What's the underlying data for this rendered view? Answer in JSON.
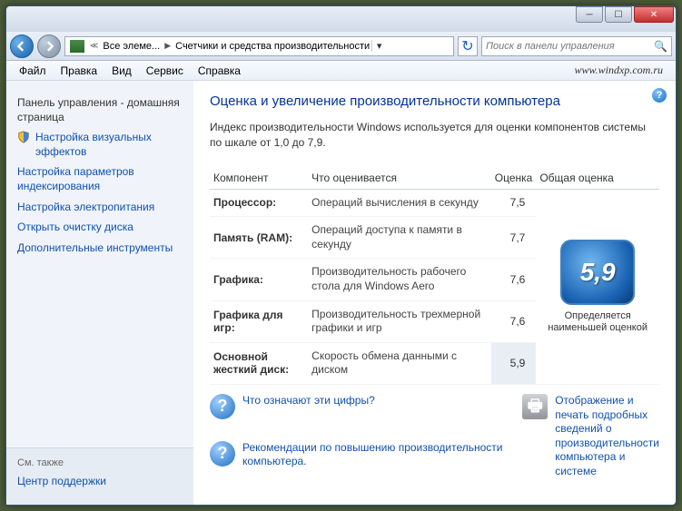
{
  "titlebar": {
    "min": "─",
    "max": "☐",
    "close": "✕"
  },
  "nav": {
    "bc_root": "Все элеме...",
    "bc_current": "Счетчики и средства производительности",
    "search_placeholder": "Поиск в панели управления"
  },
  "menu": {
    "file": "Файл",
    "edit": "Правка",
    "view": "Вид",
    "service": "Сервис",
    "help": "Справка"
  },
  "watermark": "www.windxp.com.ru",
  "sidebar": {
    "home": "Панель управления - домашняя страница",
    "links": [
      "Настройка визуальных эффектов",
      "Настройка параметров индексирования",
      "Настройка электропитания",
      "Открыть очистку диска",
      "Дополнительные инструменты"
    ],
    "see_also_label": "См. также",
    "see_also": "Центр поддержки"
  },
  "main": {
    "title": "Оценка и увеличение производительности компьютера",
    "intro": "Индекс производительности Windows используется для оценки компонентов системы по шкале от 1,0 до 7,9.",
    "headers": {
      "component": "Компонент",
      "what": "Что оценивается",
      "score": "Оценка",
      "overall": "Общая оценка"
    },
    "rows": [
      {
        "comp": "Процессор:",
        "desc": "Операций вычисления в секунду",
        "score": "7,5"
      },
      {
        "comp": "Память (RAM):",
        "desc": "Операций доступа к памяти в секунду",
        "score": "7,7"
      },
      {
        "comp": "Графика:",
        "desc": "Производительность рабочего стола для Windows Aero",
        "score": "7,6"
      },
      {
        "comp": "Графика для игр:",
        "desc": "Производительность трехмерной графики и игр",
        "score": "7,6"
      },
      {
        "comp": "Основной жесткий диск:",
        "desc": "Скорость обмена данными с диском",
        "score": "5,9",
        "hl": true
      }
    ],
    "overall_score": "5,9",
    "overall_text": "Определяется наименьшей оценкой",
    "footer": {
      "what_numbers": "Что означают эти цифры?",
      "print_details": "Отображение и печать подробных сведений о производительности компьютера и системе",
      "recommend": "Рекомендации по повышению производительности компьютера."
    }
  }
}
